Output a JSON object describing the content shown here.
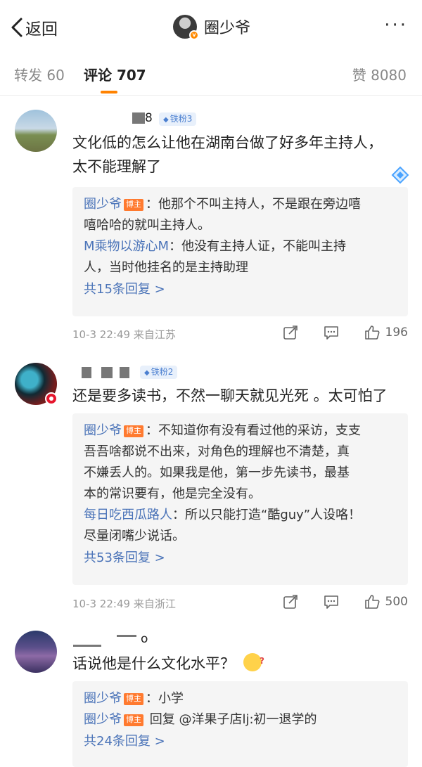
{
  "nav": {
    "back_label": "返回",
    "title": "圈少爷",
    "more_label": "···"
  },
  "tabs": {
    "repost": "转发 60",
    "comment": "评论 707",
    "like": "赞 8080"
  },
  "comments": [
    {
      "username_tail": "8",
      "fan_badge": "铁粉3",
      "text_lines": [
        "文化低的怎么让他在湖南台做了好多年主持人，",
        "太不能理解了"
      ],
      "replies": [
        {
          "name": "圈少爷",
          "is_host": true,
          "host_tag": "博主",
          "text_lines": [
            "：他那个不叫主持人，不是跟在旁边嘻",
            "嘻哈哈的就叫主持人。"
          ]
        },
        {
          "name": "M乘物以游心M",
          "is_host": false,
          "text_lines": [
            "：他没有主持人证，不能叫主持",
            "人，当时他挂名的是主持助理"
          ]
        }
      ],
      "more_replies": "共15条回复 >",
      "time": "10-3 22:49",
      "source": "来自江苏",
      "likes": "196"
    },
    {
      "username_tail": "",
      "fan_badge": "铁粉2",
      "text_lines": [
        "还是要多读书，不然一聊天就见光死 。太可怕了"
      ],
      "replies": [
        {
          "name": "圈少爷",
          "is_host": true,
          "host_tag": "博主",
          "text_lines": [
            "：不知道你有没有看过他的采访，支支",
            "吾吾啥都说不出来，对角色的理解也不清楚，真",
            "不嫌丢人的。如果我是他，第一步先读书，最基",
            "本的常识要有，他是完全没有。"
          ]
        },
        {
          "name": "每日吃西瓜路人",
          "is_host": false,
          "text_lines": [
            "：所以只能打造“酷guy”人设咯！",
            "尽量闭嘴少说话。"
          ]
        }
      ],
      "more_replies": "共53条回复 >",
      "time": "10-3 22:49",
      "source": "来自浙江",
      "likes": "500"
    },
    {
      "username_tail": "o",
      "text_lines": [
        "话说他是什么文化水平？"
      ],
      "replies": [
        {
          "name": "圈少爷",
          "is_host": true,
          "host_tag": "博主",
          "text_lines": [
            "：小学"
          ]
        },
        {
          "name": "圈少爷",
          "is_host": true,
          "host_tag": "博主",
          "text_lines": [
            " 回复 @洋果子店lj:初一退学的"
          ]
        }
      ],
      "more_replies": "共24条回复 >"
    }
  ]
}
